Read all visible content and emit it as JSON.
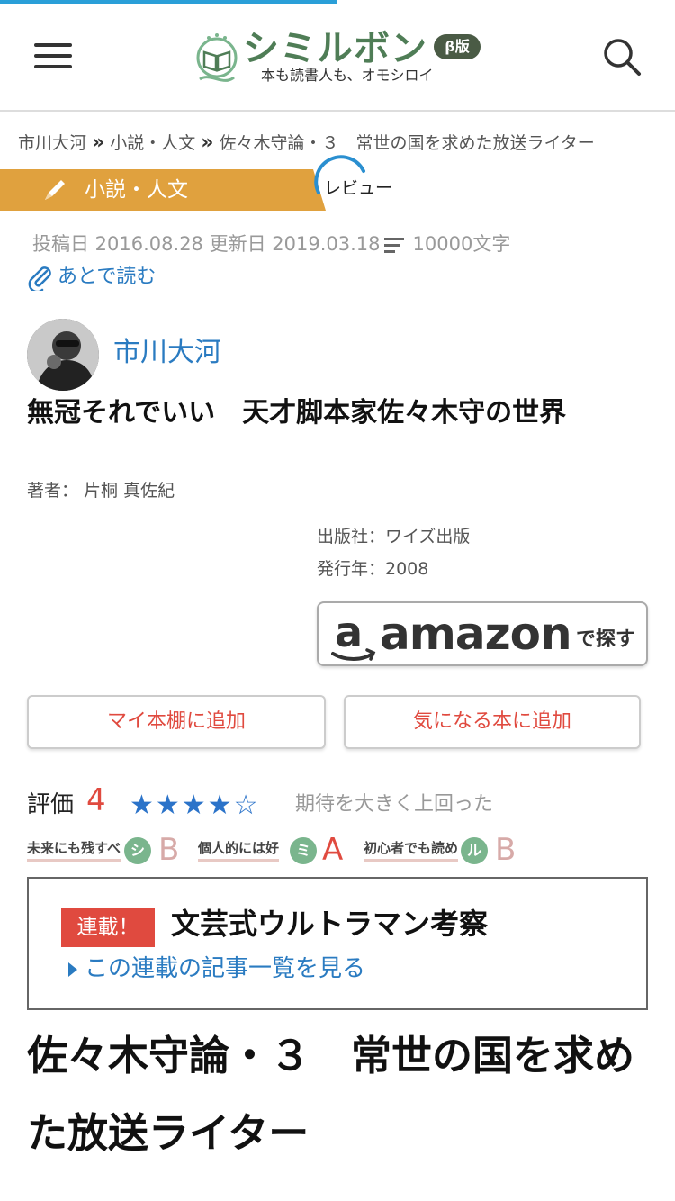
{
  "header": {
    "logo_text": "シミルボン",
    "logo_badge": "β版",
    "logo_tagline": "本も読書人も、オモシロイ"
  },
  "breadcrumb": {
    "items": [
      "市川大河",
      "小説・人文",
      "佐々木守論・３　常世の国を求めた放送ライター"
    ],
    "separator": "»"
  },
  "category": {
    "label": "小説・人文",
    "type": "レビュー"
  },
  "meta": {
    "posted": "投稿日 2016.08.28",
    "updated": "更新日 2019.03.18",
    "length": "10000文字",
    "read_later": "あとで読む"
  },
  "author": {
    "name": "市川大河"
  },
  "book": {
    "title": "無冠それでいい　天才脚本家佐々木守の世界",
    "author": "著者：  片桐 真佐紀",
    "publisher": "出版社：ワイズ出版",
    "year": "発行年：2008",
    "amazon_logo": "amazon",
    "amazon_find": "で探す"
  },
  "actions": {
    "add_shelf": "マイ本棚に追加",
    "add_want": "気になる本に追加"
  },
  "rating": {
    "label": "評価",
    "value": "4",
    "stars_filled": 4,
    "stars_total": 5,
    "stars": "★★★★☆",
    "comment": "期待を大きく上回った"
  },
  "grades": [
    {
      "label": "未来にも残すべ",
      "mark": "シ",
      "grade": "B"
    },
    {
      "label": "個人的には好",
      "mark": "ミ",
      "grade": "A"
    },
    {
      "label": "初心者でも読め",
      "mark": "ル",
      "grade": "B"
    }
  ],
  "series": {
    "badge": "連載！",
    "title": "文芸式ウルトラマン考察",
    "link": "この連載の記事一覧を見る"
  },
  "article": {
    "title": "佐々木守論・３　常世の国を求めた放送ライター"
  },
  "colors": {
    "accent_blue": "#2a7bc1",
    "accent_red": "#e04a3f",
    "category_orange": "#e0a13e",
    "logo_green": "#4f7d56"
  }
}
